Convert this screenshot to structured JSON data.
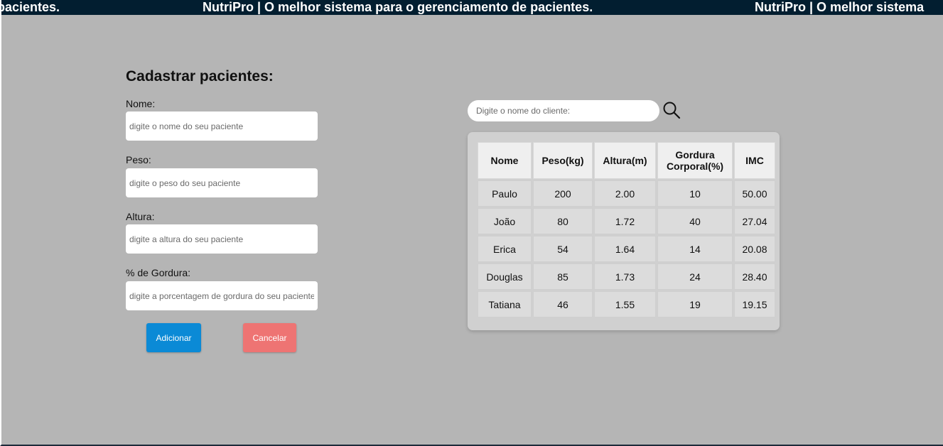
{
  "banner": {
    "text": "NutriPro | O melhor sistema para o gerenciamento de pacientes.",
    "fragment_left": "pacientes.",
    "fragment_right": "NutriPro | O melhor sistema"
  },
  "form": {
    "title": "Cadastrar pacientes:",
    "fields": [
      {
        "label": "Nome:",
        "placeholder": "digite o nome do seu paciente",
        "value": ""
      },
      {
        "label": "Peso:",
        "placeholder": "digite o peso do seu paciente",
        "value": ""
      },
      {
        "label": "Altura:",
        "placeholder": "digite a altura do seu paciente",
        "value": ""
      },
      {
        "label": "% de Gordura:",
        "placeholder": "digite a porcentagem de gordura do seu paciente",
        "value": ""
      }
    ],
    "add_label": "Adicionar",
    "cancel_label": "Cancelar"
  },
  "search": {
    "placeholder": "Digite o nome do cliente:",
    "icon": "search-icon"
  },
  "table": {
    "headers": [
      "Nome",
      "Peso(kg)",
      "Altura(m)",
      "Gordura Corporal(%)",
      "IMC"
    ],
    "rows": [
      [
        "Paulo",
        "200",
        "2.00",
        "10",
        "50.00"
      ],
      [
        "João",
        "80",
        "1.72",
        "40",
        "27.04"
      ],
      [
        "Erica",
        "54",
        "1.64",
        "14",
        "20.08"
      ],
      [
        "Douglas",
        "85",
        "1.73",
        "24",
        "28.40"
      ],
      [
        "Tatiana",
        "46",
        "1.55",
        "19",
        "19.15"
      ]
    ]
  },
  "colors": {
    "background": "#b5b5b5",
    "banner": "#021e30",
    "add_button": "#0b8ad6",
    "cancel_button": "#ee7473"
  }
}
